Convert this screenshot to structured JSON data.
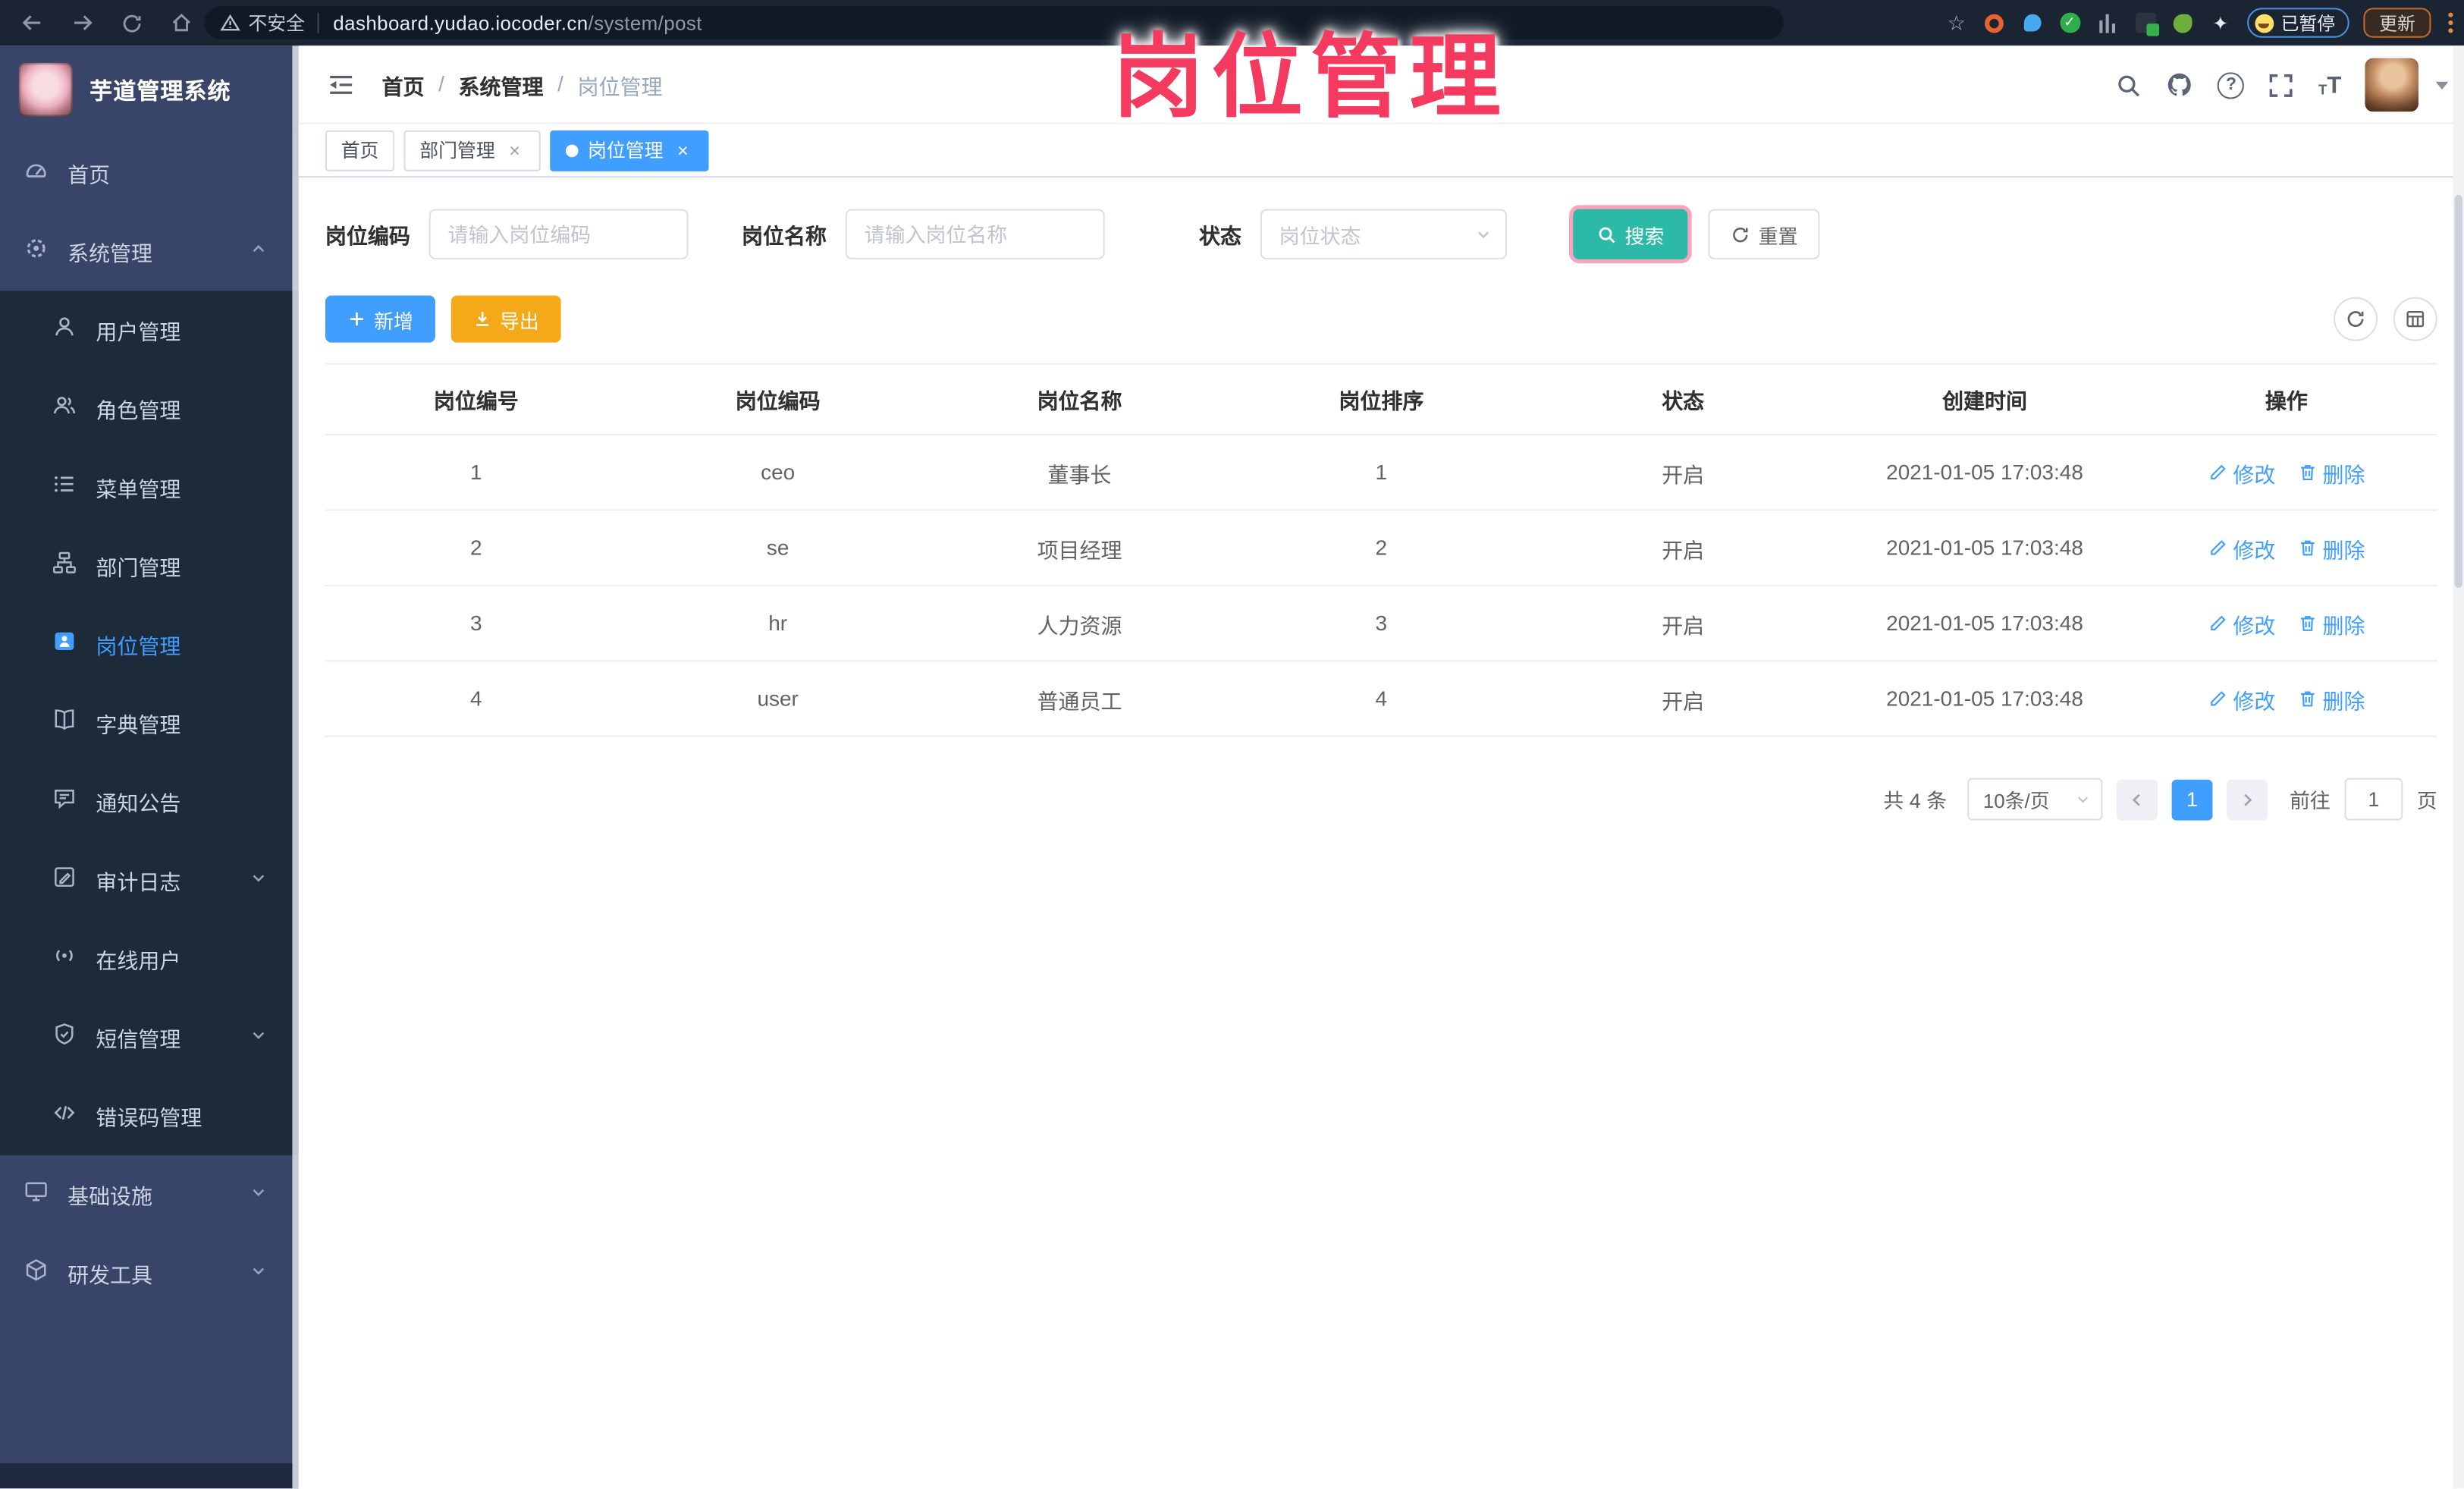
{
  "browser": {
    "security_label": "不安全",
    "url_domain": "dashboard.yudao.iocoder.cn",
    "url_path": "/system/post",
    "paused_label": "已暂停",
    "update_label": "更新"
  },
  "watermark": {
    "text": "岗位管理",
    "color": "#f43b5f"
  },
  "sidebar": {
    "title": "芋道管理系统",
    "items": [
      {
        "label": "首页"
      },
      {
        "label": "系统管理"
      },
      {
        "label": "用户管理"
      },
      {
        "label": "角色管理"
      },
      {
        "label": "菜单管理"
      },
      {
        "label": "部门管理"
      },
      {
        "label": "岗位管理"
      },
      {
        "label": "字典管理"
      },
      {
        "label": "通知公告"
      },
      {
        "label": "审计日志"
      },
      {
        "label": "在线用户"
      },
      {
        "label": "短信管理"
      },
      {
        "label": "错误码管理"
      },
      {
        "label": "基础设施"
      },
      {
        "label": "研发工具"
      }
    ]
  },
  "header": {
    "breadcrumb": [
      {
        "label": "首页"
      },
      {
        "label": "系统管理"
      },
      {
        "label": "岗位管理"
      }
    ],
    "separator": "/"
  },
  "tabs": [
    {
      "label": "首页"
    },
    {
      "label": "部门管理"
    },
    {
      "label": "岗位管理"
    }
  ],
  "filters": {
    "code_label": "岗位编码",
    "code_placeholder": "请输入岗位编码",
    "name_label": "岗位名称",
    "name_placeholder": "请输入岗位名称",
    "status_label": "状态",
    "status_placeholder": "岗位状态",
    "search_label": "搜索",
    "reset_label": "重置"
  },
  "toolbar": {
    "add_label": "新增",
    "export_label": "导出"
  },
  "table": {
    "headers": [
      "岗位编号",
      "岗位编码",
      "岗位名称",
      "岗位排序",
      "状态",
      "创建时间",
      "操作"
    ],
    "edit_label": "修改",
    "delete_label": "删除",
    "rows": [
      {
        "no": "1",
        "code": "ceo",
        "name": "董事长",
        "sort": "1",
        "status": "开启",
        "created": "2021-01-05 17:03:48"
      },
      {
        "no": "2",
        "code": "se",
        "name": "项目经理",
        "sort": "2",
        "status": "开启",
        "created": "2021-01-05 17:03:48"
      },
      {
        "no": "3",
        "code": "hr",
        "name": "人力资源",
        "sort": "3",
        "status": "开启",
        "created": "2021-01-05 17:03:48"
      },
      {
        "no": "4",
        "code": "user",
        "name": "普通员工",
        "sort": "4",
        "status": "开启",
        "created": "2021-01-05 17:03:48"
      }
    ]
  },
  "pagination": {
    "total": "共 4 条",
    "page_size": "10条/页",
    "current_page": "1",
    "goto_label": "前往",
    "goto_value": "1",
    "page_suffix": "页"
  },
  "icons": {
    "close": "×",
    "star": "☆",
    "check": "✓",
    "question": "?",
    "font_large": "T",
    "font_small": "T",
    "sparkle": "✦"
  },
  "colors": {
    "accent": "#409eff",
    "search_teal": "#2cb9a8",
    "export_orange": "#f5a818",
    "watermark_pink": "#f43b5f",
    "sidebar_bg": "#384468",
    "submenu_bg": "#1c2a3a"
  }
}
